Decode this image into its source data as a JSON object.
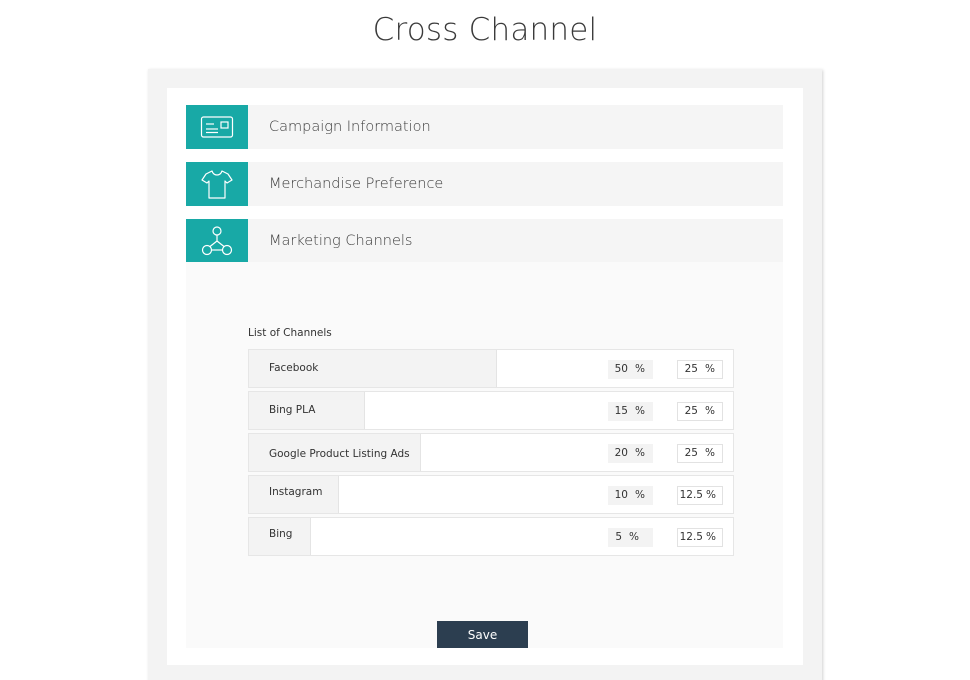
{
  "page": {
    "title": "Cross Channel"
  },
  "colors": {
    "accent": "#18a9a6",
    "button": "#2c3e50"
  },
  "sections": [
    {
      "label": "Campaign Information",
      "icon": "id-card-icon"
    },
    {
      "label": "Merchandise Preference",
      "icon": "tshirt-icon"
    },
    {
      "label": "Marketing Channels",
      "icon": "network-nodes-icon"
    }
  ],
  "channels": {
    "heading": "List of Channels",
    "rows": [
      {
        "name": "Facebook",
        "value_a": "50",
        "unit_a": "%",
        "value_b": "25",
        "unit_b": "%"
      },
      {
        "name": "Bing PLA",
        "value_a": "15",
        "unit_a": "%",
        "value_b": "25",
        "unit_b": "%"
      },
      {
        "name": "Google Product Listing Ads",
        "value_a": "20",
        "unit_a": "%",
        "value_b": "25",
        "unit_b": "%"
      },
      {
        "name": "Instagram",
        "value_a": "10",
        "unit_a": "%",
        "value_b": "12.5",
        "unit_b": "%"
      },
      {
        "name": "Bing",
        "value_a": "5",
        "unit_a": "%",
        "value_b": "12.5",
        "unit_b": "%"
      }
    ]
  },
  "actions": {
    "save_label": "Save"
  }
}
